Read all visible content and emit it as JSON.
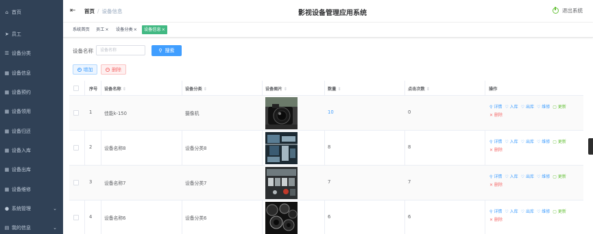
{
  "sidebar": {
    "items": [
      {
        "label": "首页",
        "icon": "home-icon",
        "glyph": "⌂"
      },
      {
        "label": "员工",
        "icon": "send-icon",
        "glyph": "➤"
      },
      {
        "label": "设备分类",
        "icon": "list-icon",
        "glyph": "☰"
      },
      {
        "label": "设备信息",
        "icon": "grid-icon",
        "glyph": "▦"
      },
      {
        "label": "设备预约",
        "icon": "grid-icon",
        "glyph": "▦"
      },
      {
        "label": "设备领用",
        "icon": "grid-icon",
        "glyph": "▦"
      },
      {
        "label": "设备归还",
        "icon": "grid-icon",
        "glyph": "▦"
      },
      {
        "label": "设备入库",
        "icon": "grid-icon",
        "glyph": "▦"
      },
      {
        "label": "设备出库",
        "icon": "grid-icon",
        "glyph": "▦"
      },
      {
        "label": "设备维修",
        "icon": "grid-icon",
        "glyph": "▦"
      },
      {
        "label": "系统管理",
        "icon": "user-icon",
        "glyph": "●",
        "chevron": "⌄"
      },
      {
        "label": "我的信息",
        "icon": "doc-icon",
        "glyph": "▤",
        "chevron": "⌄"
      }
    ]
  },
  "header": {
    "breadcrumb_home": "首页",
    "breadcrumb_sep": "/",
    "breadcrumb_current": "设备信息",
    "title": "影视设备管理应用系统",
    "logout": "退出系统"
  },
  "tags": [
    {
      "label": "系统首页",
      "close": ""
    },
    {
      "label": "员工",
      "close": "×"
    },
    {
      "label": "设备分类",
      "close": "×"
    },
    {
      "label": "设备信息",
      "close": "×",
      "active": true
    }
  ],
  "search": {
    "label": "设备名称",
    "placeholder": "设备名称",
    "button": "搜索"
  },
  "actions": {
    "add": "增加",
    "delete": "删除"
  },
  "table": {
    "headers": {
      "index": "序号",
      "name": "设备名称",
      "category": "设备分类",
      "image": "设备图片",
      "quantity": "数量",
      "clicks": "点击次数",
      "ops": "操作"
    },
    "sort_glyph": "⇕",
    "rows": [
      {
        "index": "1",
        "name": "佳能k-150",
        "category": "摄像机",
        "quantity": "10",
        "clicks": "0"
      },
      {
        "index": "2",
        "name": "设备名称8",
        "category": "设备分类8",
        "quantity": "8",
        "clicks": "8"
      },
      {
        "index": "3",
        "name": "设备名称7",
        "category": "设备分类7",
        "quantity": "7",
        "clicks": "7"
      },
      {
        "index": "4",
        "name": "设备名称6",
        "category": "设备分类6",
        "quantity": "6",
        "clicks": "6"
      }
    ],
    "row_ops": {
      "detail": "详情",
      "stock_in": "入库",
      "stock_out": "出库",
      "repair": "维修",
      "update": "更新",
      "remove": "删除"
    }
  },
  "colors": {
    "sidebar_bg": "#304156",
    "sidebar_text": "#bfcbd9",
    "primary": "#409eff",
    "active_tag": "#42b983",
    "danger": "#f56c6c",
    "success": "#67c23a"
  }
}
